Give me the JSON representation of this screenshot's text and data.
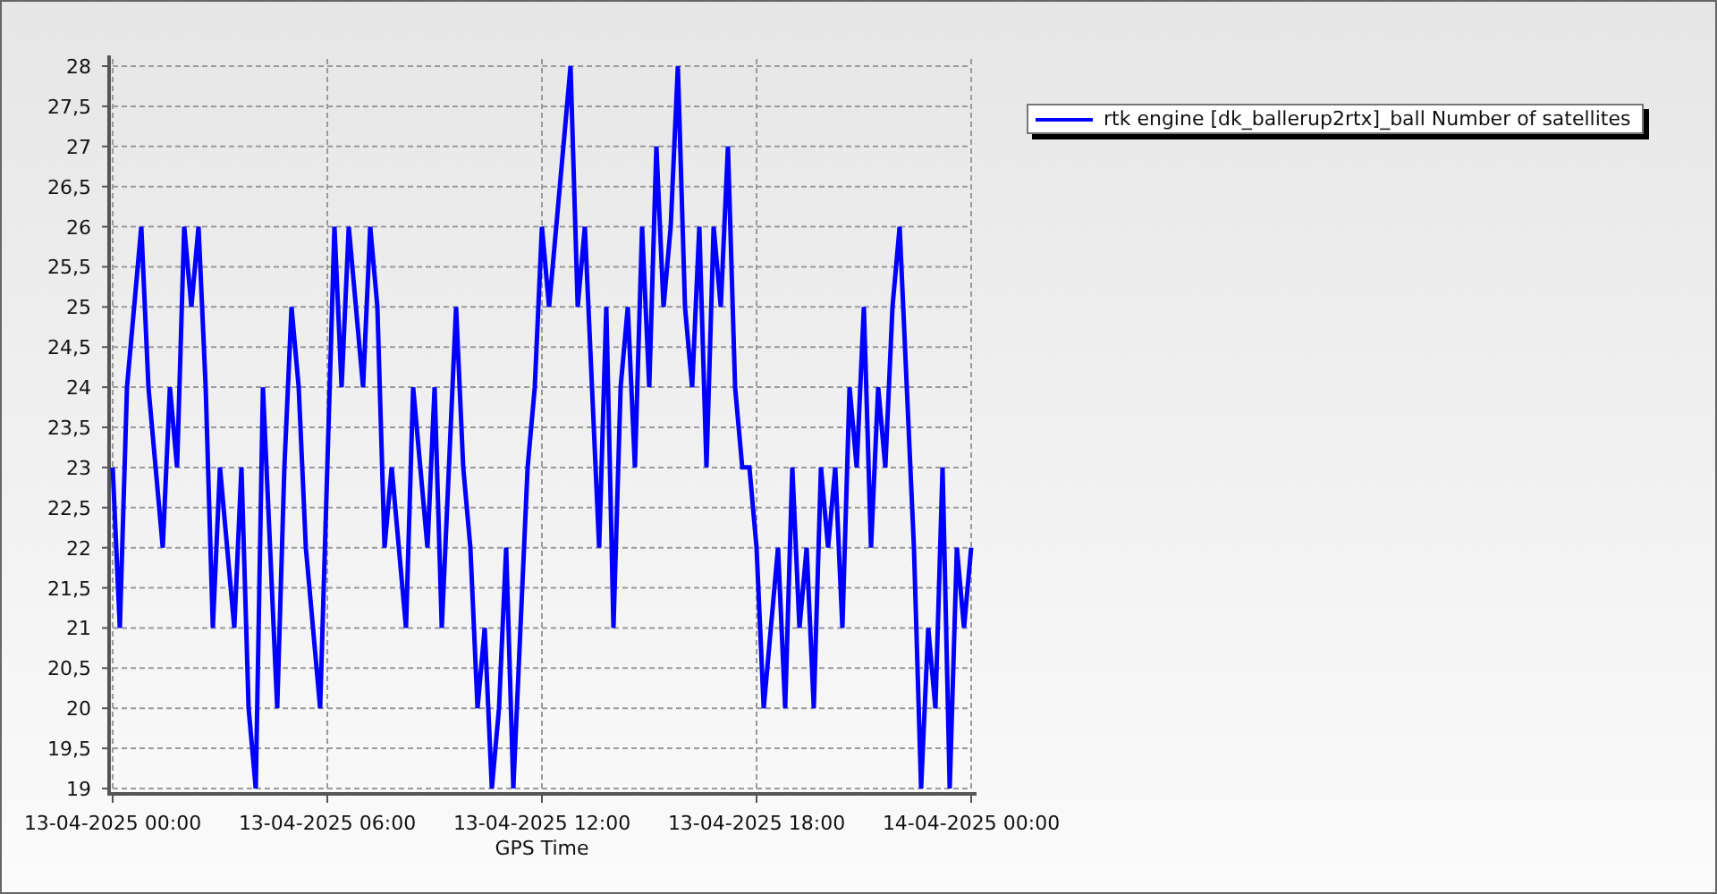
{
  "chart_data": {
    "type": "line",
    "xlabel": "GPS Time",
    "ylim": [
      19,
      28
    ],
    "grid": true,
    "categories": [
      "13-04-2025 00:00",
      null,
      null,
      null,
      null,
      null,
      null,
      null,
      null,
      null,
      null,
      null,
      null,
      null,
      null,
      null,
      null,
      null,
      null,
      null,
      null,
      null,
      null,
      null,
      null,
      null,
      null,
      null,
      null,
      null,
      "13-04-2025 06:00",
      null,
      null,
      null,
      null,
      null,
      null,
      null,
      null,
      null,
      null,
      null,
      null,
      null,
      null,
      null,
      null,
      null,
      null,
      null,
      null,
      null,
      null,
      null,
      null,
      null,
      null,
      null,
      null,
      null,
      "13-04-2025 12:00",
      null,
      null,
      null,
      null,
      null,
      null,
      null,
      null,
      null,
      null,
      null,
      null,
      null,
      null,
      null,
      null,
      null,
      null,
      null,
      null,
      null,
      null,
      null,
      null,
      null,
      null,
      null,
      null,
      null,
      "13-04-2025 18:00",
      null,
      null,
      null,
      null,
      null,
      null,
      null,
      null,
      null,
      null,
      null,
      null,
      null,
      null,
      null,
      null,
      null,
      null,
      null,
      null,
      null,
      null,
      null,
      null,
      null,
      null,
      null,
      null,
      null,
      "14-04-2025 00:00"
    ],
    "yticks": [
      {
        "value": 19,
        "label": "19"
      },
      {
        "value": 19.5,
        "label": "19,5"
      },
      {
        "value": 20,
        "label": "20"
      },
      {
        "value": 20.5,
        "label": "20,5"
      },
      {
        "value": 21,
        "label": "21"
      },
      {
        "value": 21.5,
        "label": "21,5"
      },
      {
        "value": 22,
        "label": "22"
      },
      {
        "value": 22.5,
        "label": "22,5"
      },
      {
        "value": 23,
        "label": "23"
      },
      {
        "value": 23.5,
        "label": "23,5"
      },
      {
        "value": 24,
        "label": "24"
      },
      {
        "value": 24.5,
        "label": "24,5"
      },
      {
        "value": 25,
        "label": "25"
      },
      {
        "value": 25.5,
        "label": "25,5"
      },
      {
        "value": 26,
        "label": "26"
      },
      {
        "value": 26.5,
        "label": "26,5"
      },
      {
        "value": 27,
        "label": "27"
      },
      {
        "value": 27.5,
        "label": "27,5"
      },
      {
        "value": 28,
        "label": "28"
      }
    ],
    "series": [
      {
        "name": "rtk engine [dk_ballerup2rtx]_ball Number of satellites",
        "color": "#0000ff",
        "values": [
          23,
          21,
          24,
          25,
          26,
          24,
          23,
          22,
          24,
          23,
          26,
          25,
          26,
          24,
          21,
          23,
          22,
          21,
          23,
          20,
          19,
          24,
          22,
          20,
          23,
          25,
          24,
          22,
          21,
          20,
          23,
          26,
          24,
          26,
          25,
          24,
          26,
          25,
          22,
          23,
          22,
          21,
          24,
          23,
          22,
          24,
          21,
          23,
          25,
          23,
          22,
          20,
          21,
          19,
          20,
          22,
          19,
          21,
          23,
          24,
          26,
          25,
          26,
          27,
          28,
          25,
          26,
          24,
          22,
          25,
          21,
          24,
          25,
          23,
          26,
          24,
          27,
          25,
          26,
          28,
          25,
          24,
          26,
          23,
          26,
          25,
          27,
          24,
          23,
          23,
          22,
          20,
          21,
          22,
          20,
          23,
          21,
          22,
          20,
          23,
          22,
          23,
          21,
          24,
          23,
          25,
          22,
          24,
          23,
          25,
          26,
          24,
          22,
          19,
          21,
          20,
          23,
          19,
          22,
          21,
          22
        ]
      }
    ]
  }
}
